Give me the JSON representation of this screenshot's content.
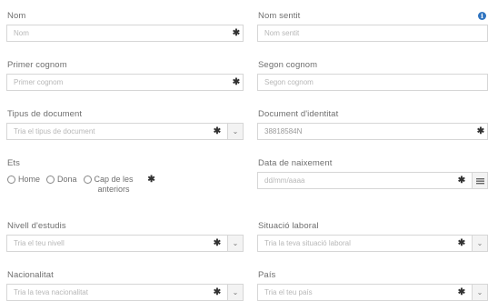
{
  "form": {
    "nom": {
      "label": "Nom",
      "placeholder": "Nom"
    },
    "nom_sentit": {
      "label": "Nom sentit",
      "placeholder": "Nom sentit"
    },
    "primer_cognom": {
      "label": "Primer cognom",
      "placeholder": "Primer cognom"
    },
    "segon_cognom": {
      "label": "Segon cognom",
      "placeholder": "Segon cognom"
    },
    "tipus_document": {
      "label": "Tipus de document",
      "placeholder": "Tria el tipus de document"
    },
    "document_identitat": {
      "label": "Document d'identitat",
      "value": "38818584N"
    },
    "ets": {
      "label": "Ets",
      "options": [
        "Home",
        "Dona",
        "Cap de les",
        "anteriors"
      ]
    },
    "data_naixement": {
      "label": "Data de naixement",
      "placeholder": "dd/mm/aaaa"
    },
    "nivell_estudis": {
      "label": "Nivell d'estudis",
      "placeholder": "Tria el teu nivell"
    },
    "situacio_laboral": {
      "label": "Situació laboral",
      "placeholder": "Tria la teva situació laboral"
    },
    "nacionalitat": {
      "label": "Nacionalitat",
      "placeholder": "Tria la teva nacionalitat"
    },
    "pais": {
      "label": "País",
      "placeholder": "Tria el teu país"
    },
    "required_mark": "✱",
    "dropdown_caret": "⌄"
  },
  "icons": {
    "info": "info-icon",
    "calendar": "calendar-icon"
  },
  "colors": {
    "info_blue": "#2f74c0",
    "border": "#d6d6d6"
  }
}
